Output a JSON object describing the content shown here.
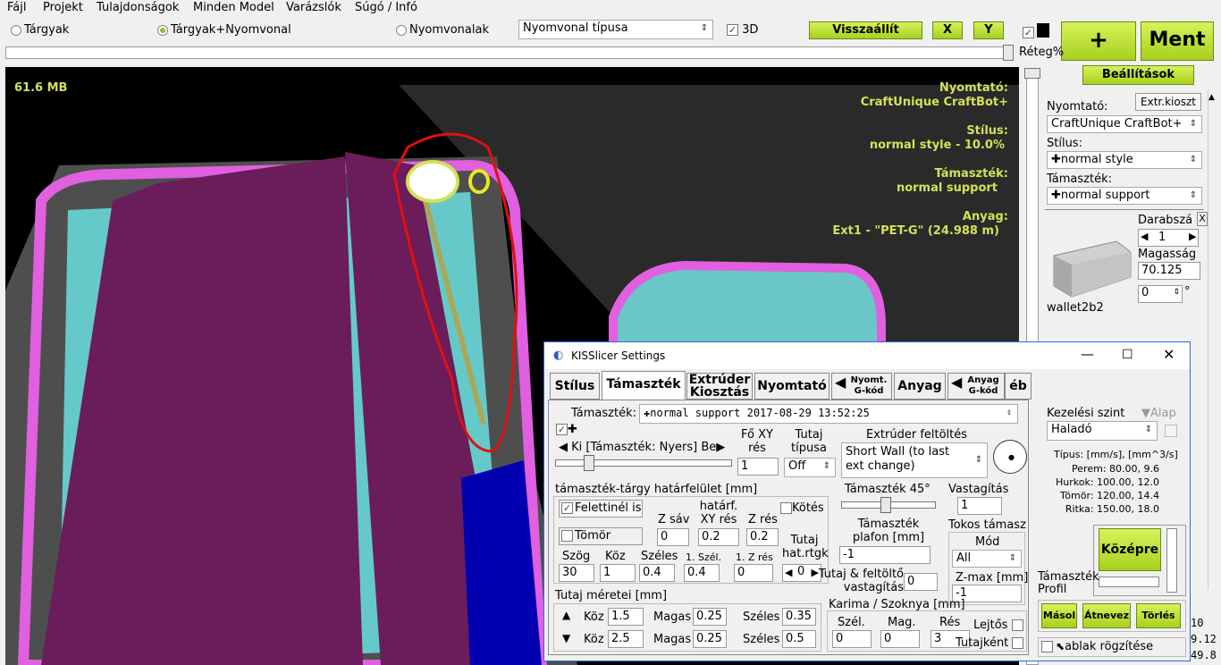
{
  "menu": [
    "Fájl",
    "Projekt",
    "Tulajdonságok",
    "Minden Model",
    "Varázslók",
    "Súgó / Infó"
  ],
  "toolbar": {
    "radio_objects": "Tárgyak",
    "radio_objects_paths": "Tárgyak+Nyomvonal",
    "radio_paths": "Nyomvonalak",
    "path_type": "Nyomvonal típusa",
    "chk_3d": "3D",
    "restore": "Visszaállít",
    "x_btn": "X",
    "y_btn": "Y",
    "plus": "+",
    "save": "Ment",
    "layer_label": "Réteg%",
    "settings": "Beállítások"
  },
  "viewport": {
    "memory": "61.6 MB",
    "printer_label": "Nyomtató:",
    "printer": "CraftUnique CraftBot+",
    "style_label": "Stílus:",
    "style": "normal style -  10.0%",
    "support_label": "Támaszték:",
    "support": "normal support",
    "material_label": "Anyag:",
    "material": "Ext1 - \"PET-G\" (24.988 m)"
  },
  "right": {
    "printer_label": "Nyomtató:",
    "extr_btn": "Extr.kioszt",
    "printer": "CraftUnique CraftBot+",
    "style_label": "Stílus:",
    "style": "normal style",
    "support_label": "Támaszték:",
    "support": "normal support",
    "count_label": "Darabszá",
    "x": "X",
    "count": "1",
    "height_label": "Magasság",
    "height": "70.125",
    "angle": "0",
    "deg": "°",
    "model_name": "wallet2b2"
  },
  "dialog": {
    "title": "KISSlicer Settings",
    "tabs": [
      "Stílus",
      "Támaszték",
      "Extrúder Kiosztás",
      "Nyomtató",
      "Nyomt. G-kód",
      "Anyag",
      "Anyag G-kód",
      "éb"
    ],
    "support_label": "Támaszték:",
    "support_value": "normal support  2017-08-29 13:52:25",
    "ki_label": "Ki [Támaszték: Nyers] Be",
    "main_xy_label": "Fő XY rés",
    "main_xy": "1",
    "raft_type_label": "Tutaj típusa",
    "raft_type": "Off",
    "extr_fill_label": "Extrúder feltöltés",
    "extr_fill": "Short Wall (to last ext change)",
    "interface_label": "támaszték-tárgy határfelület [mm]",
    "above_too": "Felettinél is",
    "solid": "Tömör",
    "z_band_label": "Z sáv",
    "z_band": "0",
    "limit_xy_label": "határf. XY rés",
    "limit_xy": "0.2",
    "z_gap_label": "Z rés",
    "z_gap": "0.2",
    "bind": "Kötés",
    "angle_label": "Szög",
    "angle": "30",
    "gap_label": "Köz",
    "gap": "1",
    "width_label": "Széles",
    "width": "0.4",
    "first_w_label": "1. Szél.",
    "first_w": "0.4",
    "first_z_label": "1. Z rés",
    "first_z": "0",
    "raft_lim_label": "Tutaj hat.rtgk",
    "raft_lim": "0",
    "support45_label": "Támaszték 45°",
    "thicken_label": "Vastagítás",
    "thicken": "1",
    "ceiling_label": "Támaszték plafon [mm]",
    "ceiling": "-1",
    "fill_thicken_label": "Tutaj & feltöltő vastagítás",
    "fill_thicken": "0",
    "tokos_label": "Tokos támasz",
    "mode_label": "Mód",
    "mode": "All",
    "zmax_label": "Z-max [mm]",
    "zmax": "-1",
    "raft_size_label": "Tutaj méretei [mm]",
    "koz1_label": "Köz",
    "koz1": "1.5",
    "magas1_label": "Magas",
    "magas1": "0.25",
    "szeles1_label": "Széles",
    "szeles1": "0.35",
    "koz2_label": "Köz",
    "koz2": "2.5",
    "magas2_label": "Magas",
    "magas2": "0.25",
    "szeles2_label": "Széles",
    "szeles2": "0.5",
    "brim_label": "Karima / Szoknya [mm]",
    "brim_w_label": "Szél.",
    "brim_w": "0",
    "brim_h_label": "Mag.",
    "brim_h": "0",
    "brim_gap_label": "Rés",
    "brim_gap": "3",
    "lejtos": "Lejtős",
    "tutajkent": "Tutajként",
    "level_label": "Kezelési szint",
    "level_default": "Alap",
    "level": "Haladó",
    "speed_header": "Típus: [mm/s], [mm^3/s]",
    "speeds": [
      "Perem:  80.00,  9.6",
      "Hurkok:  100.00,  12.0",
      "Tömör:  120.00,  14.4",
      "Ritka:  150.00,  18.0"
    ],
    "center": "Középre",
    "profile_label": "Támaszték Profil",
    "copy": "Másol",
    "rename": "Átnevez",
    "delete": "Törlés",
    "lock_window": "ablak rögzítése"
  },
  "corner_numbers": [
    "10",
    "9.12",
    "49.8"
  ]
}
